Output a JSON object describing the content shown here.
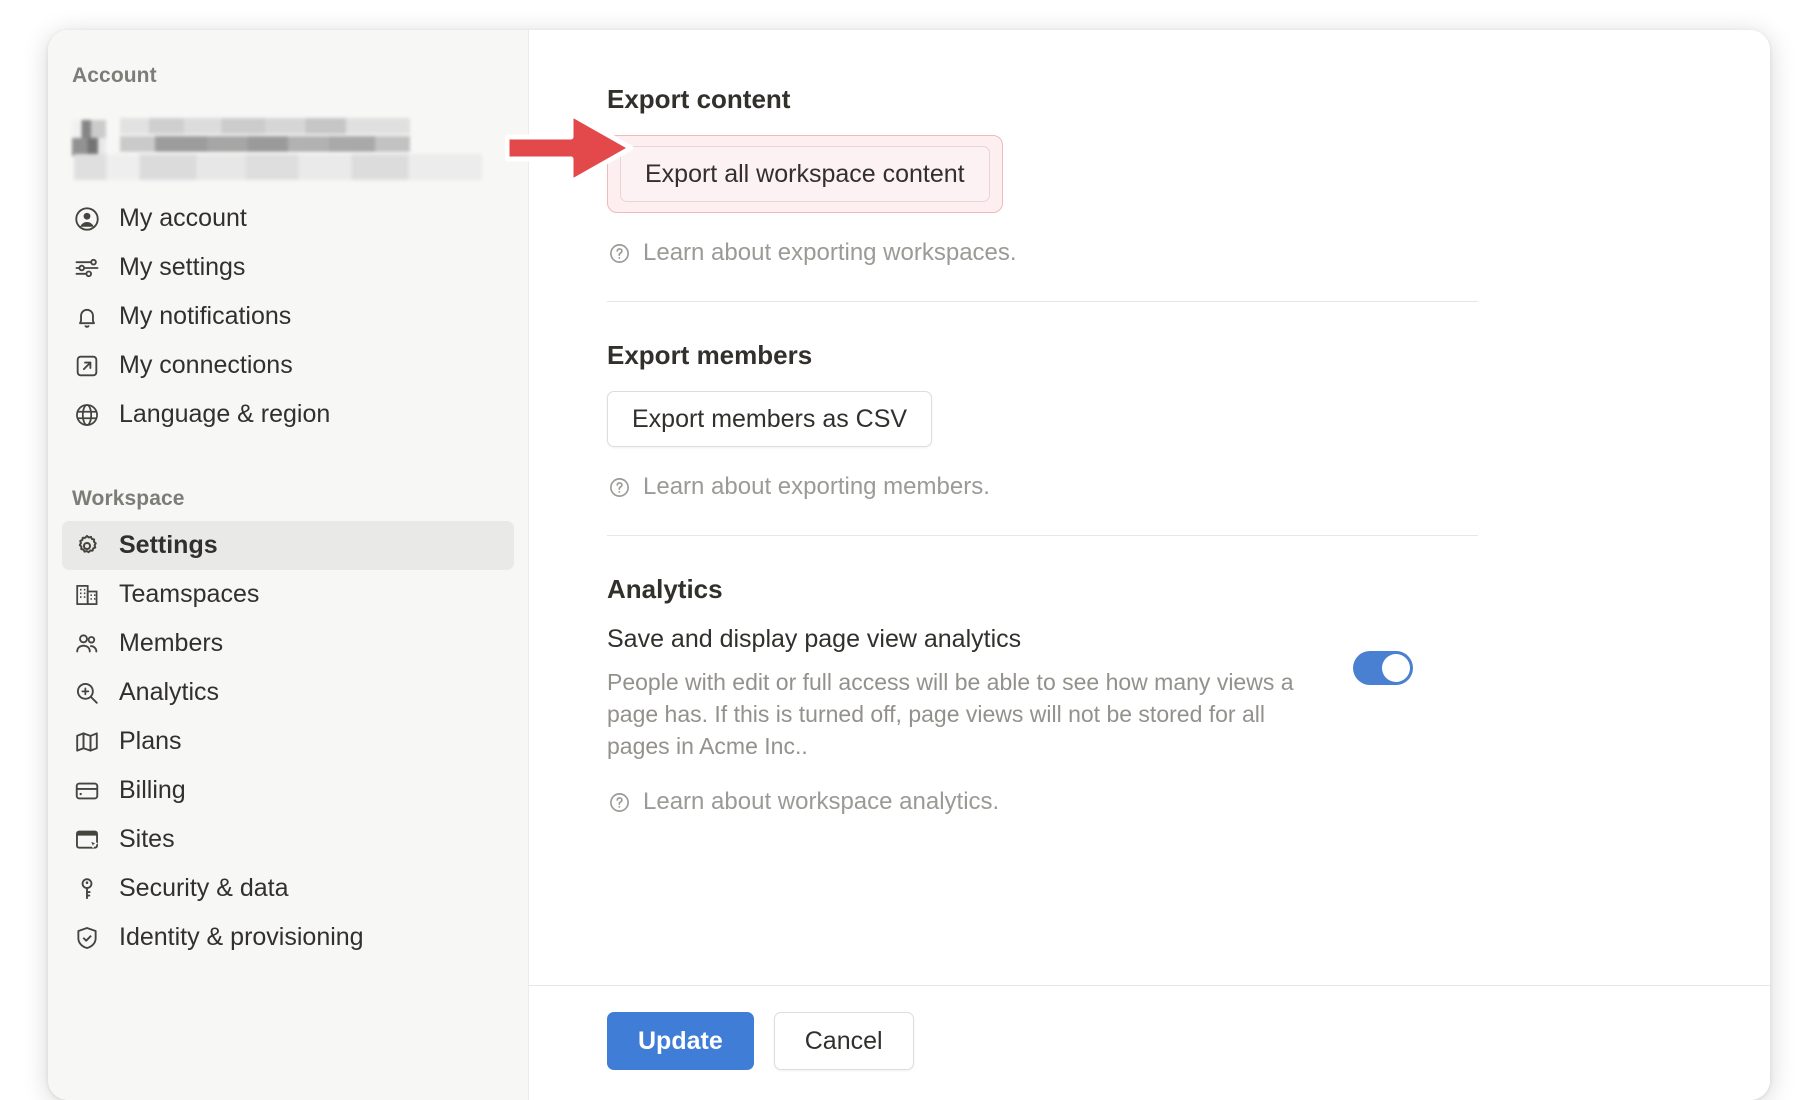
{
  "sidebar": {
    "account_section_label": "Account",
    "workspace_section_label": "Workspace",
    "account_items": [
      {
        "label": "My account",
        "icon": "user-circle-icon"
      },
      {
        "label": "My settings",
        "icon": "sliders-icon"
      },
      {
        "label": "My notifications",
        "icon": "bell-icon"
      },
      {
        "label": "My connections",
        "icon": "external-link-icon"
      },
      {
        "label": "Language & region",
        "icon": "globe-icon"
      }
    ],
    "workspace_items": [
      {
        "label": "Settings",
        "icon": "gear-icon",
        "active": true
      },
      {
        "label": "Teamspaces",
        "icon": "building-icon",
        "active": false
      },
      {
        "label": "Members",
        "icon": "people-icon",
        "active": false
      },
      {
        "label": "Analytics",
        "icon": "magnifier-plus-icon",
        "active": false
      },
      {
        "label": "Plans",
        "icon": "map-icon",
        "active": false
      },
      {
        "label": "Billing",
        "icon": "credit-card-icon",
        "active": false
      },
      {
        "label": "Sites",
        "icon": "browser-cursor-icon",
        "active": false
      },
      {
        "label": "Security & data",
        "icon": "key-icon",
        "active": false
      },
      {
        "label": "Identity & provisioning",
        "icon": "shield-check-icon",
        "active": false
      }
    ]
  },
  "main": {
    "export_content": {
      "title": "Export content",
      "button_label": "Export all workspace content",
      "learn_label": "Learn about exporting workspaces.",
      "highlight_color": "#f0b9bb"
    },
    "export_members": {
      "title": "Export members",
      "button_label": "Export members as CSV",
      "learn_label": "Learn about exporting members."
    },
    "analytics": {
      "title": "Analytics",
      "setting_title": "Save and display page view analytics",
      "description": "People with edit or full access will be able to see how many views a page has. If this is turned off, page views will not be stored for all pages in Acme Inc..",
      "learn_label": "Learn about workspace analytics.",
      "toggle_state": "on",
      "toggle_color": "#4a80d2"
    }
  },
  "footer": {
    "update_label": "Update",
    "cancel_label": "Cancel",
    "primary_color": "#3f7dd6"
  },
  "annotation": {
    "type": "arrow",
    "direction": "right",
    "color": "#e3494b",
    "points_at": "Export all workspace content"
  }
}
